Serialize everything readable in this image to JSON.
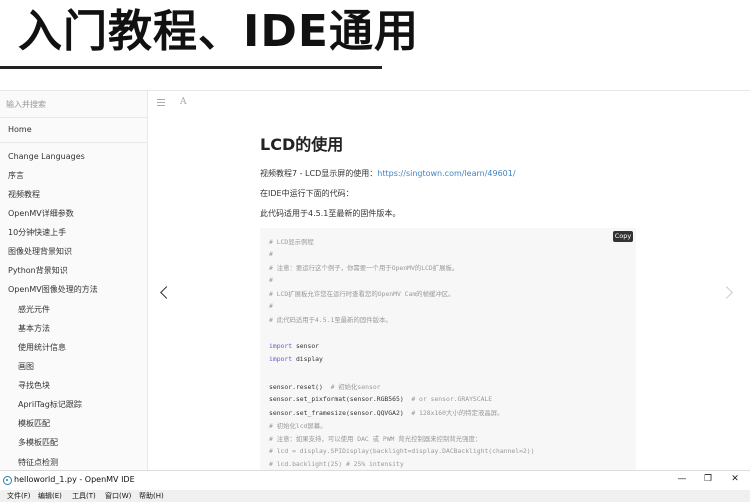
{
  "banner": {
    "title": "入门教程、IDE通用"
  },
  "sidebar": {
    "search_placeholder": "输入并搜索",
    "home": "Home",
    "items": [
      "Change Languages",
      "序言",
      "视频教程",
      "OpenMV详细参数",
      "10分钟快速上手",
      "图像处理背景知识",
      "Python背景知识",
      "OpenMV图像处理的方法"
    ],
    "subitems": [
      "感光元件",
      "基本方法",
      "使用统计信息",
      "画图",
      "寻找色块",
      "AprilTag标记跟踪",
      "模板匹配",
      "多模板匹配",
      "特征点检测"
    ]
  },
  "toolbar": {
    "font_label": "A"
  },
  "content": {
    "title": "LCD的使用",
    "video_label": "视频教程7 - LCD显示屏的使用：",
    "video_link": "https://singtown.com/learn/49601/",
    "run_text": "在IDE中运行下面的代码：",
    "version_text": "此代码适用于4.5.1至最新的固件版本。",
    "copy_label": "Copy",
    "code_lines": [
      "# LCD显示例程",
      "#",
      "# 注意：要运行这个例子，你需要一个用于OpenMV的LCD扩展板。",
      "#",
      "# LCD扩展板允许您在运行时查看您的OpenMV Cam的帧缓冲区。",
      "#",
      "# 此代码适用于4.5.1至最新的固件版本。",
      "",
      "import sensor",
      "import display",
      "",
      "sensor.reset()  # 初始化sensor",
      "sensor.set_pixformat(sensor.RGB565)  # or sensor.GRAYSCALE",
      "sensor.set_framesize(sensor.QQVGA2)  # 128x160大小的特定液晶屏。",
      "# 初始化lcd屏幕。",
      "# 注意：如果支持，可以使用 DAC 或 PWM 背光控制器来控制背光强度：",
      "# lcd = display.SPIDisplay(backlight=display.DACBacklight(channel=2))",
      "# lcd.backlight(25) # 25% intensity"
    ]
  },
  "window": {
    "title": "helloworld_1.py - OpenMV IDE",
    "minimize": "—",
    "restore": "❐",
    "close": "✕",
    "menu": [
      "文件(F)",
      "编辑(E)",
      "工具(T)",
      "窗口(W)",
      "帮助(H)"
    ]
  },
  "colors": {
    "link": "#4183c4",
    "code_bg": "#f7f7f7",
    "keyword": "#6a5acd",
    "comment": "#999999"
  }
}
